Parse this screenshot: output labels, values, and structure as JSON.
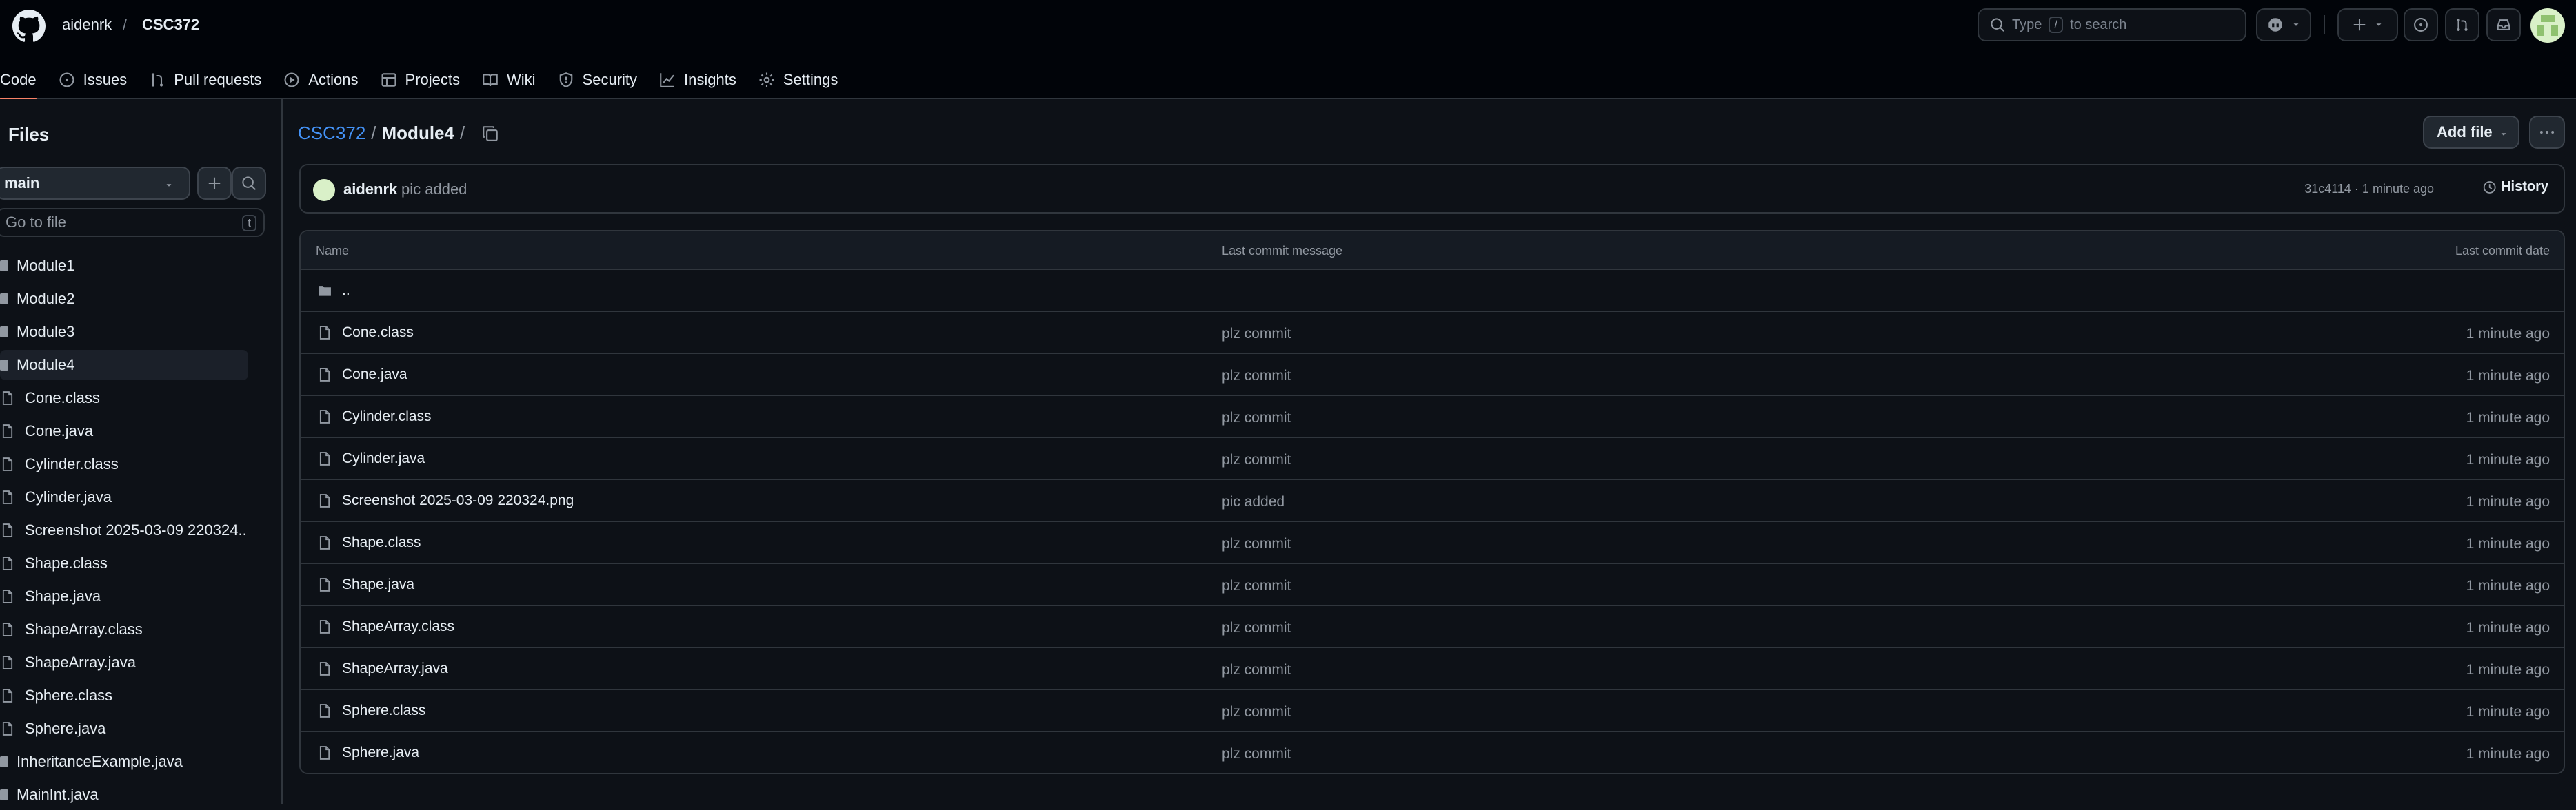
{
  "topbar": {
    "owner": "aidenrk",
    "slash": "/",
    "repo": "CSC372",
    "search_prefix": "Type",
    "search_key": "/",
    "search_suffix": "to search"
  },
  "tabs": [
    {
      "label": "Code",
      "icon": "code-icon"
    },
    {
      "label": "Issues",
      "icon": "issue-icon"
    },
    {
      "label": "Pull requests",
      "icon": "pull-request-icon"
    },
    {
      "label": "Actions",
      "icon": "play-icon"
    },
    {
      "label": "Projects",
      "icon": "table-icon"
    },
    {
      "label": "Wiki",
      "icon": "book-icon"
    },
    {
      "label": "Security",
      "icon": "shield-icon"
    },
    {
      "label": "Insights",
      "icon": "graph-icon"
    },
    {
      "label": "Settings",
      "icon": "gear-icon"
    }
  ],
  "sidebar": {
    "title": "Files",
    "branch": "main",
    "goto_placeholder": "Go to file",
    "goto_key": "t",
    "items": [
      {
        "label": "Module1",
        "type": "dir"
      },
      {
        "label": "Module2",
        "type": "dir"
      },
      {
        "label": "Module3",
        "type": "dir"
      },
      {
        "label": "Module4",
        "type": "dir"
      },
      {
        "label": "Cone.class",
        "type": "file"
      },
      {
        "label": "Cone.java",
        "type": "file"
      },
      {
        "label": "Cylinder.class",
        "type": "file"
      },
      {
        "label": "Cylinder.java",
        "type": "file"
      },
      {
        "label": "Screenshot 2025-03-09 220324....",
        "type": "file"
      },
      {
        "label": "Shape.class",
        "type": "file"
      },
      {
        "label": "Shape.java",
        "type": "file"
      },
      {
        "label": "ShapeArray.class",
        "type": "file"
      },
      {
        "label": "ShapeArray.java",
        "type": "file"
      },
      {
        "label": "Sphere.class",
        "type": "file"
      },
      {
        "label": "Sphere.java",
        "type": "file"
      },
      {
        "label": "InheritanceExample.java",
        "type": "dirfile"
      },
      {
        "label": "MainInt.java",
        "type": "dirfile"
      }
    ]
  },
  "main": {
    "breadcrumb_repo": "CSC372",
    "breadcrumb_sep": "/",
    "breadcrumb_dir": "Module4",
    "breadcrumb_trail": "/",
    "add_file": "Add file",
    "commit": {
      "author": "aidenrk",
      "message": "pic added",
      "meta": "31c4114 · 1 minute ago",
      "history": "History"
    },
    "table": {
      "headers": [
        "Name",
        "Last commit message",
        "Last commit date"
      ],
      "parent": "..",
      "rows": [
        {
          "name": "Cone.class",
          "msg": "plz commit",
          "date": "1 minute ago"
        },
        {
          "name": "Cone.java",
          "msg": "plz commit",
          "date": "1 minute ago"
        },
        {
          "name": "Cylinder.class",
          "msg": "plz commit",
          "date": "1 minute ago"
        },
        {
          "name": "Cylinder.java",
          "msg": "plz commit",
          "date": "1 minute ago"
        },
        {
          "name": "Screenshot 2025-03-09 220324.png",
          "msg": "pic added",
          "date": "1 minute ago"
        },
        {
          "name": "Shape.class",
          "msg": "plz commit",
          "date": "1 minute ago"
        },
        {
          "name": "Shape.java",
          "msg": "plz commit",
          "date": "1 minute ago"
        },
        {
          "name": "ShapeArray.class",
          "msg": "plz commit",
          "date": "1 minute ago"
        },
        {
          "name": "ShapeArray.java",
          "msg": "plz commit",
          "date": "1 minute ago"
        },
        {
          "name": "Sphere.class",
          "msg": "plz commit",
          "date": "1 minute ago"
        },
        {
          "name": "Sphere.java",
          "msg": "plz commit",
          "date": "1 minute ago"
        }
      ]
    }
  }
}
